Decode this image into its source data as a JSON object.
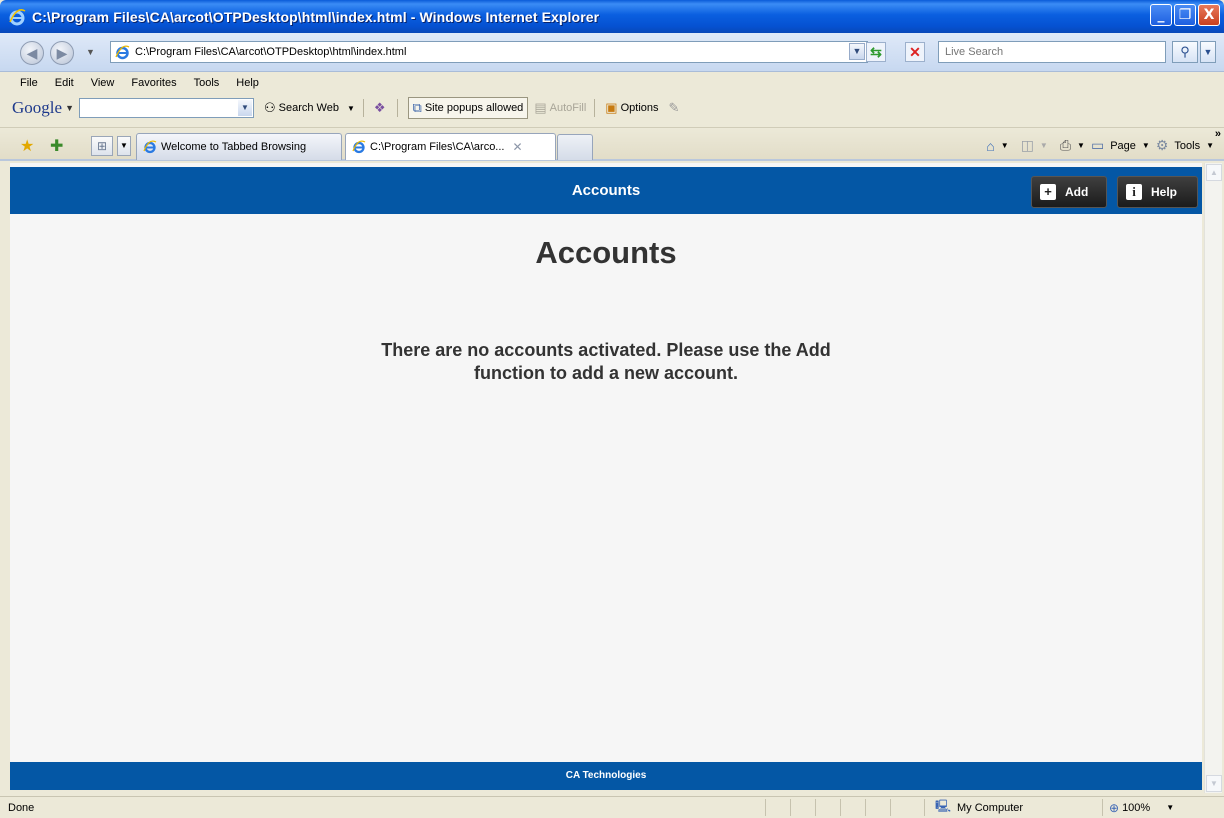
{
  "window": {
    "title": "C:\\Program Files\\CA\\arcot\\OTPDesktop\\html\\index.html - Windows Internet Explorer",
    "minimize_label": "_",
    "restore_label": "❐",
    "close_label": "X"
  },
  "address_bar": {
    "url": "C:\\Program Files\\CA\\arcot\\OTPDesktop\\html\\index.html",
    "search_placeholder": "Live Search"
  },
  "menu": {
    "items": [
      "File",
      "Edit",
      "View",
      "Favorites",
      "Tools",
      "Help"
    ]
  },
  "google_toolbar": {
    "logo_part1": "Goo",
    "logo_part2": "gle",
    "search_web_label": "Search Web",
    "popups_label": "Site popups allowed",
    "autofill_label": "AutoFill",
    "options_label": "Options"
  },
  "tabs": [
    {
      "label": "Welcome to Tabbed Browsing",
      "active": false
    },
    {
      "label": "C:\\Program Files\\CA\\arco...",
      "active": true
    }
  ],
  "command_bar": {
    "page_label": "Page",
    "tools_label": "Tools"
  },
  "app": {
    "header_title": "Accounts",
    "add_label": "Add",
    "help_label": "Help",
    "page_heading": "Accounts",
    "message_line1": "There are no accounts activated. Please use the Add",
    "message_line2": "function to add a new account.",
    "footer": "CA Technologies"
  },
  "status_bar": {
    "status": "Done",
    "zone": "My Computer",
    "zoom": "100%"
  },
  "colors": {
    "app_blue": "#0457a5",
    "button_dark": "#2b2b2b",
    "content_bg": "#f6f6f6",
    "xp_title_blue": "#0a5fe0"
  },
  "icons": [
    "ie-logo-icon",
    "back-icon",
    "forward-icon",
    "refresh-icon",
    "stop-icon",
    "search-icon",
    "favorites-star-icon",
    "add-favorites-icon",
    "quick-tabs-icon",
    "home-icon",
    "feeds-icon",
    "print-icon",
    "page-icon",
    "tools-gear-icon",
    "plus-icon",
    "info-icon",
    "computer-icon",
    "zoom-icon"
  ]
}
